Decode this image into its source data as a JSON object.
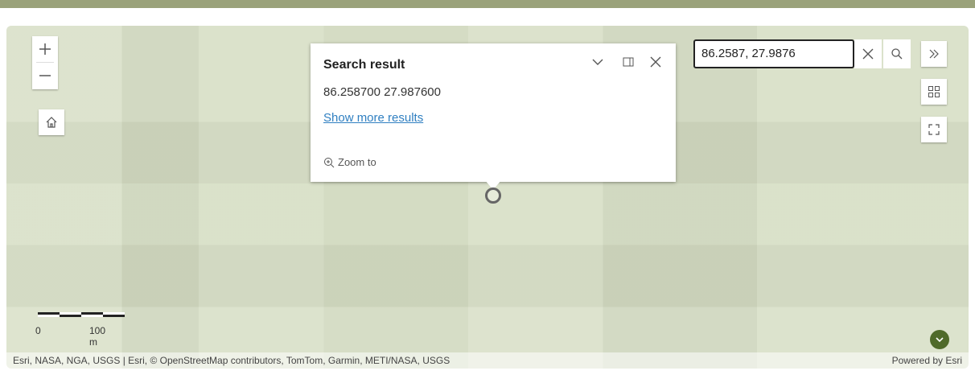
{
  "map": {
    "controls": {
      "zoom_in_icon": "plus-icon",
      "zoom_out_icon": "minus-icon",
      "home_icon": "home-icon",
      "toggle_panel_icon": "double-chevron-right-icon",
      "basemap_icon": "basemap-gallery-icon",
      "fullscreen_icon": "fullscreen-icon"
    },
    "search": {
      "value": "86.2587, 27.9876",
      "clear_icon": "close-icon",
      "search_icon": "search-icon"
    },
    "popup": {
      "title": "Search result",
      "coordinates": "86.258700 27.987600",
      "more_link": "Show more results",
      "zoom_to": "Zoom to"
    },
    "scale": {
      "start": "0",
      "end": "100 m"
    },
    "attribution": {
      "left": "Esri, NASA, NGA, USGS | Esri, © OpenStreetMap contributors, TomTom, Garmin, METI/NASA, USGS",
      "right": "Powered by Esri"
    }
  },
  "colors": {
    "map_bg": "#d6dec4",
    "top_band": "#9aa27a",
    "link": "#2f7fc1",
    "badge": "#4f6a2a"
  }
}
